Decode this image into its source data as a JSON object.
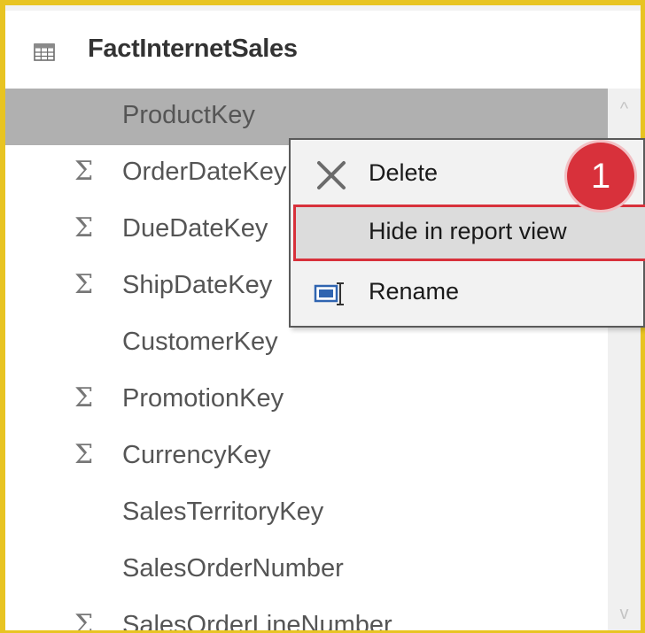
{
  "table": {
    "name": "FactInternetSales",
    "icon": "table-grid-icon"
  },
  "fields": [
    {
      "label": "ProductKey",
      "sigma": false,
      "selected": true
    },
    {
      "label": "OrderDateKey",
      "sigma": true
    },
    {
      "label": "DueDateKey",
      "sigma": true
    },
    {
      "label": "ShipDateKey",
      "sigma": true
    },
    {
      "label": "CustomerKey",
      "sigma": false
    },
    {
      "label": "PromotionKey",
      "sigma": true
    },
    {
      "label": "CurrencyKey",
      "sigma": true
    },
    {
      "label": "SalesTerritoryKey",
      "sigma": false
    },
    {
      "label": "SalesOrderNumber",
      "sigma": false
    },
    {
      "label": "SalesOrderLineNumber",
      "sigma": true
    }
  ],
  "sigma_symbol": "Σ",
  "context_menu": {
    "items": [
      {
        "label": "Delete",
        "icon": "delete-x-icon"
      },
      {
        "label": "Hide in report view",
        "icon": "",
        "highlighted": true
      },
      {
        "label": "Rename",
        "icon": "rename-icon"
      }
    ]
  },
  "callout": {
    "number": "1"
  },
  "scrollbar": {
    "up_glyph": "^",
    "down_glyph": "v"
  },
  "colors": {
    "frame": "#e8c422",
    "selected_row": "#b0b0b0",
    "callout": "#d8313b",
    "highlight_outline": "#d8313b"
  }
}
